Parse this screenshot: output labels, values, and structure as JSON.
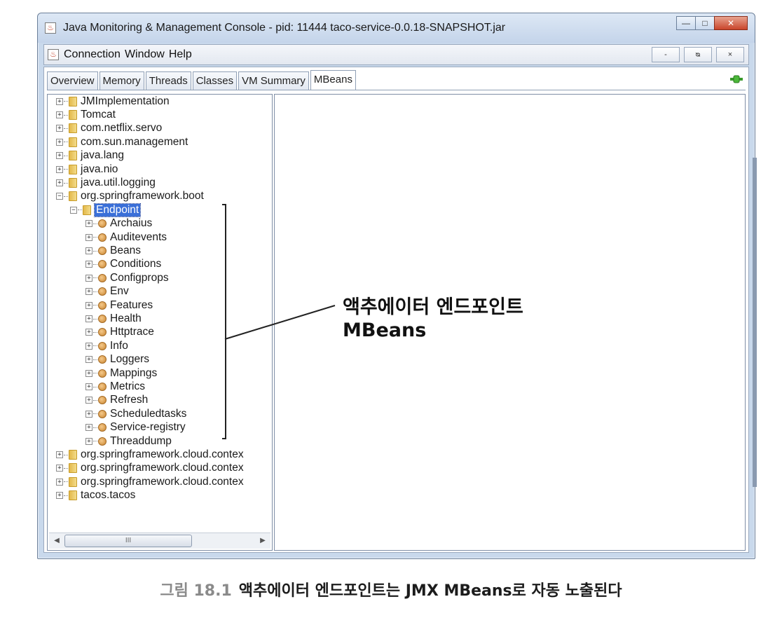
{
  "window": {
    "title": "Java Monitoring & Management Console - pid: 11444 taco-service-0.0.18-SNAPSHOT.jar",
    "controls": {
      "minimize": "—",
      "maximize": "□",
      "close": "✕"
    }
  },
  "menubar": {
    "items": [
      "Connection",
      "Window",
      "Help"
    ],
    "inner_controls": {
      "minimize": "-",
      "restore": "ᴓ",
      "close": "×"
    }
  },
  "tabs": [
    "Overview",
    "Memory",
    "Threads",
    "Classes",
    "VM Summary",
    "MBeans"
  ],
  "active_tab": "MBeans",
  "tree": {
    "top": [
      "JMImplementation",
      "Tomcat",
      "com.netflix.servo",
      "com.sun.management",
      "java.lang",
      "java.nio",
      "java.util.logging",
      "org.springframework.boot"
    ],
    "endpoint": "Endpoint",
    "endpoint_children": [
      "Archaius",
      "Auditevents",
      "Beans",
      "Conditions",
      "Configprops",
      "Env",
      "Features",
      "Health",
      "Httptrace",
      "Info",
      "Loggers",
      "Mappings",
      "Metrics",
      "Refresh",
      "Scheduledtasks",
      "Service-registry",
      "Threaddump"
    ],
    "bottom": [
      "org.springframework.cloud.contex",
      "org.springframework.cloud.contex",
      "org.springframework.cloud.contex",
      "tacos.tacos"
    ]
  },
  "scrollbar": {
    "left": "◀",
    "right": "▶",
    "grip": "III"
  },
  "callout": {
    "line1": "액추에이터 엔드포인트",
    "line2": "MBeans"
  },
  "caption": {
    "number": "그림 18.1",
    "text": "액추에이터 엔드포인트는 JMX MBeans로 자동 노출된다"
  },
  "colors": {
    "selection": "#3a6fd8",
    "folder": "#e3b84a",
    "bean": "#c98530",
    "plug": "#3a9a2c"
  },
  "icons": {
    "app": "java-cup-icon",
    "connection": "plug-icon",
    "folder": "folder-icon",
    "mbean": "bean-icon"
  }
}
